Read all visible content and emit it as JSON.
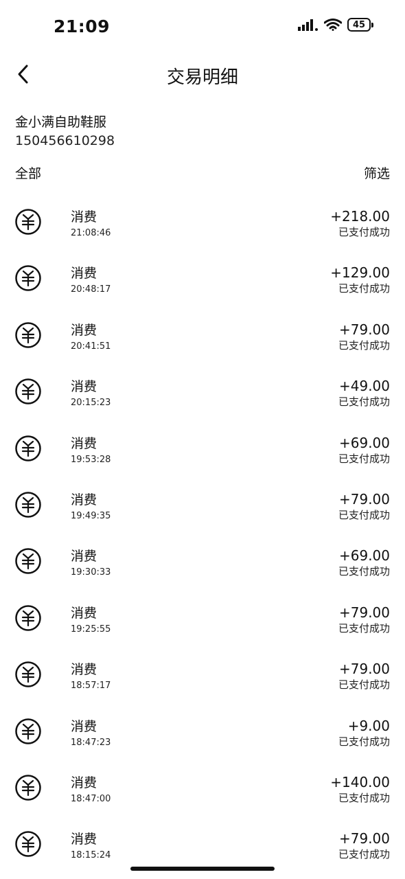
{
  "status_bar": {
    "time": "21:09",
    "battery": "45"
  },
  "nav": {
    "title": "交易明细"
  },
  "merchant": {
    "name": "金小满自助鞋服",
    "id": "150456610298"
  },
  "filters": {
    "all_label": "全部",
    "filter_label": "筛选"
  },
  "transactions": [
    {
      "type": "消费",
      "time": "21:08:46",
      "amount": "+218.00",
      "status": "已支付成功"
    },
    {
      "type": "消费",
      "time": "20:48:17",
      "amount": "+129.00",
      "status": "已支付成功"
    },
    {
      "type": "消费",
      "time": "20:41:51",
      "amount": "+79.00",
      "status": "已支付成功"
    },
    {
      "type": "消费",
      "time": "20:15:23",
      "amount": "+49.00",
      "status": "已支付成功"
    },
    {
      "type": "消费",
      "time": "19:53:28",
      "amount": "+69.00",
      "status": "已支付成功"
    },
    {
      "type": "消费",
      "time": "19:49:35",
      "amount": "+79.00",
      "status": "已支付成功"
    },
    {
      "type": "消费",
      "time": "19:30:33",
      "amount": "+69.00",
      "status": "已支付成功"
    },
    {
      "type": "消费",
      "time": "19:25:55",
      "amount": "+79.00",
      "status": "已支付成功"
    },
    {
      "type": "消费",
      "time": "18:57:17",
      "amount": "+79.00",
      "status": "已支付成功"
    },
    {
      "type": "消费",
      "time": "18:47:23",
      "amount": "+9.00",
      "status": "已支付成功"
    },
    {
      "type": "消费",
      "time": "18:47:00",
      "amount": "+140.00",
      "status": "已支付成功"
    },
    {
      "type": "消费",
      "time": "18:15:24",
      "amount": "+79.00",
      "status": "已支付成功"
    }
  ],
  "icons": {
    "back": "chevron-left-icon",
    "transaction": "yuan-coin-icon",
    "signal": "cellular-signal-icon",
    "wifi": "wifi-icon",
    "battery": "battery-icon"
  }
}
